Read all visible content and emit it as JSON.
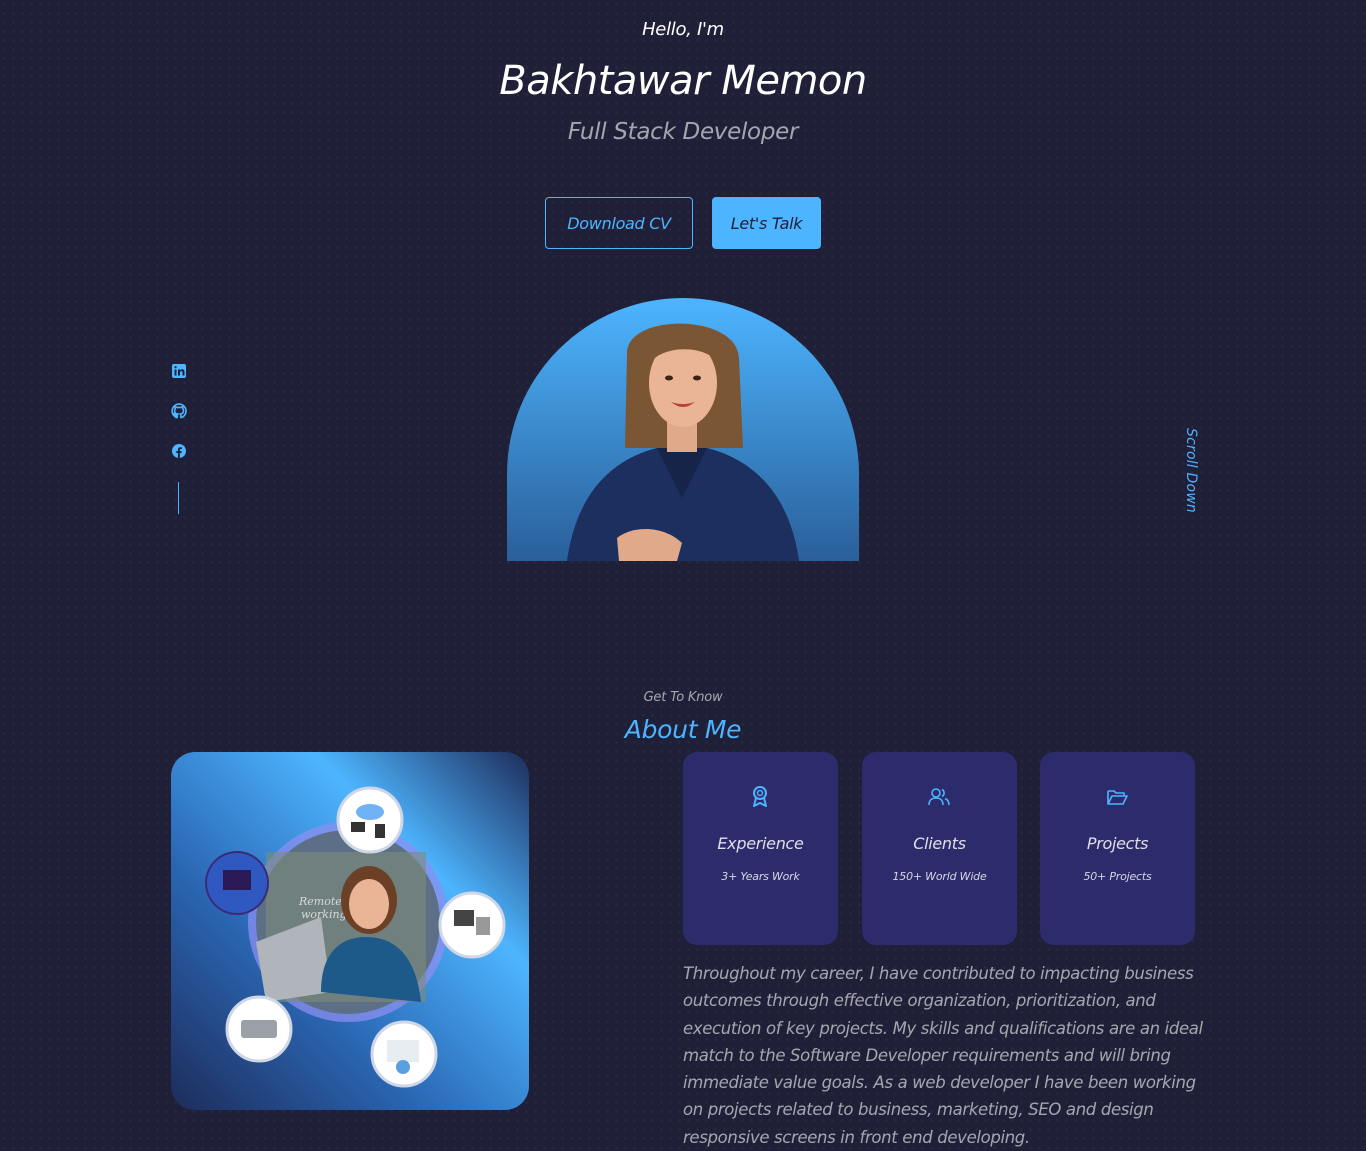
{
  "hero": {
    "greeting": "Hello, I'm",
    "name": "Bakhtawar Memon",
    "role": "Full Stack Developer",
    "download_cv_label": "Download CV",
    "lets_talk_label": "Let's Talk"
  },
  "socials": [
    "linkedin-icon",
    "github-icon",
    "facebook-icon"
  ],
  "scroll_down_label": "Scroll Down",
  "about": {
    "subtitle": "Get To Know",
    "title": "About Me",
    "cards": [
      {
        "icon": "award-icon",
        "title": "Experience",
        "subtitle": "3+ Years Work"
      },
      {
        "icon": "users-icon",
        "title": "Clients",
        "subtitle": "150+ World Wide"
      },
      {
        "icon": "folder-icon",
        "title": "Projects",
        "subtitle": "50+ Projects"
      }
    ],
    "description": "Throughout my career, I have contributed to impacting business outcomes through effective organization, prioritization, and execution of key projects. My skills and qualifications are an ideal match to the Software Developer requirements and will bring immediate value goals. As a web developer I have been working on projects related to business, marketing, SEO and design responsive screens in front end developing.",
    "image_caption": "Remote working"
  },
  "colors": {
    "background": "#1f1f38",
    "primary": "#4db5ff",
    "card": "#2c2c6c"
  }
}
